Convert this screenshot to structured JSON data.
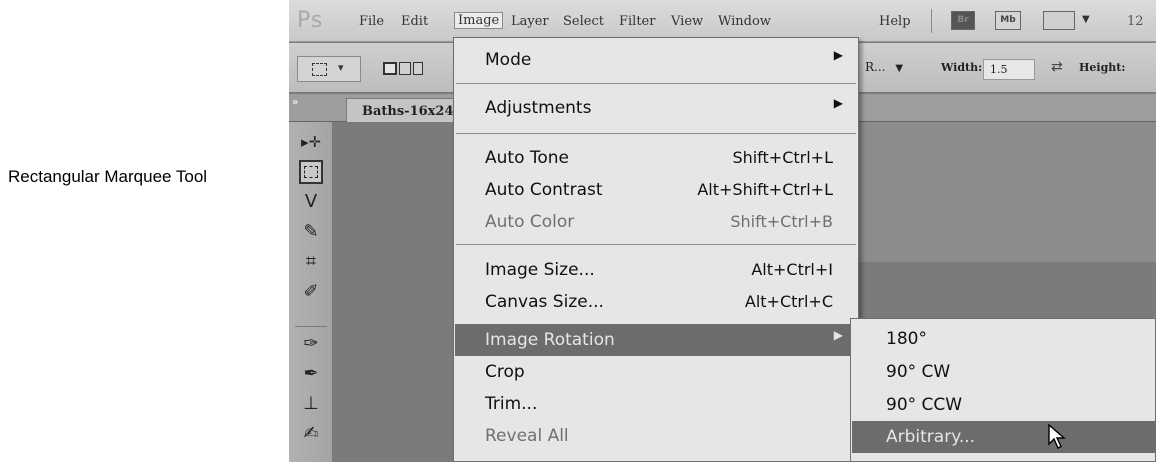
{
  "caption": "Rectangular Marquee Tool",
  "menubar": {
    "logo": "Ps",
    "items": [
      "File",
      "Edit",
      "Image",
      "Layer",
      "Select",
      "Filter",
      "View",
      "Window",
      "Help"
    ],
    "active": "Image",
    "buttons": [
      "Br",
      "Mb"
    ],
    "zoom": "12"
  },
  "options": {
    "style_value": "R...",
    "width_label": "Width:",
    "width_value": "1.5",
    "height_label": "Height:"
  },
  "document_tab": "Baths-16x24",
  "image_menu": {
    "items": [
      {
        "label": "Mode",
        "submenu": true
      },
      {
        "label": "Adjustments",
        "submenu": true
      },
      {
        "label": "Auto Tone",
        "shortcut": "Shift+Ctrl+L"
      },
      {
        "label": "Auto Contrast",
        "shortcut": "Alt+Shift+Ctrl+L"
      },
      {
        "label": "Auto Color",
        "shortcut": "Shift+Ctrl+B",
        "disabled": true
      },
      {
        "label": "Image Size...",
        "shortcut": "Alt+Ctrl+I"
      },
      {
        "label": "Canvas Size...",
        "shortcut": "Alt+Ctrl+C"
      },
      {
        "label": "Image Rotation",
        "submenu": true,
        "highlighted": true
      },
      {
        "label": "Crop"
      },
      {
        "label": "Trim..."
      },
      {
        "label": "Reveal All",
        "disabled": true
      }
    ]
  },
  "rotation_submenu": {
    "items": [
      "180°",
      "90° CW",
      "90° CCW",
      "Arbitrary..."
    ],
    "highlighted": "Arbitrary..."
  },
  "icons": {
    "submenu_arrow": "triangle-right-icon",
    "cursor": "mouse-pointer-icon"
  },
  "colors": {
    "highlight": "#6c6c6c",
    "menu_bg": "#e6e6e6"
  }
}
